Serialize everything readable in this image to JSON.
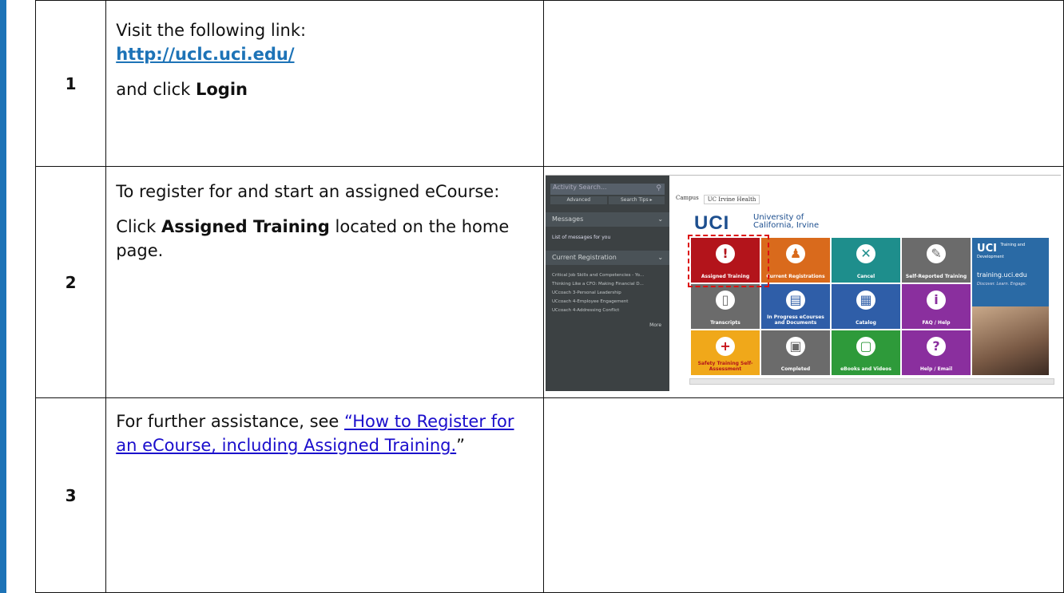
{
  "steps": [
    {
      "number": "1",
      "line1": "Visit the following link:",
      "link": "http://uclc.uci.edu/",
      "line3_prefix": "and click ",
      "line3_bold": "Login"
    },
    {
      "number": "2",
      "para1": "To register for and start an assigned eCourse:",
      "para2_prefix": "Click ",
      "para2_bold": "Assigned Training",
      "para2_suffix": " located on the home page."
    },
    {
      "number": "3",
      "prefix": "For further assistance, see ",
      "link": "“How to Register for an eCourse, including Assigned Training.",
      "suffix": "”"
    }
  ],
  "screenshot": {
    "search_placeholder": "Activity Search...",
    "advanced": "Advanced",
    "search_tips": "Search Tips ▸",
    "messages_title": "Messages",
    "messages_text": "List of messages for you",
    "current_registration": "Current Registration",
    "registrations": [
      "Critical Job Skills and Competencies - Yo...",
      "Thinking Like a CFO: Making Financial D...",
      "UCcoach 3-Personal Leadership",
      "UCcoach 4-Employee Engagement",
      "UCcoach 4-Addressing Conflict"
    ],
    "more": "More",
    "tab_campus": "Campus",
    "tab_health": "UC Irvine Health",
    "logo_text": "UCI",
    "univ_line1": "University of",
    "univ_line2": "California, Irvine",
    "tiles": [
      {
        "label": "Assigned Training",
        "icon": "!"
      },
      {
        "label": "Current Registrations",
        "icon": "♟"
      },
      {
        "label": "Cancel",
        "icon": "✕"
      },
      {
        "label": "Self-Reported Training",
        "icon": "✎"
      },
      {
        "label": "Transcripts",
        "icon": "▯"
      },
      {
        "label": "In Progress eCourses and Documents",
        "icon": "▤"
      },
      {
        "label": "Catalog",
        "icon": "▦"
      },
      {
        "label": "FAQ / Help",
        "icon": "i"
      },
      {
        "label": "Safety Training Self-Assessment",
        "icon": "+"
      },
      {
        "label": "Completed",
        "icon": "▣"
      },
      {
        "label": "eBooks and Videos",
        "icon": "▢"
      },
      {
        "label": "Help / Email",
        "icon": "?"
      }
    ],
    "promo_title": "UCI",
    "promo_sub": "Training and Development",
    "promo_site": "training.uci.edu",
    "promo_tag": "Discover. Learn. Engage."
  }
}
